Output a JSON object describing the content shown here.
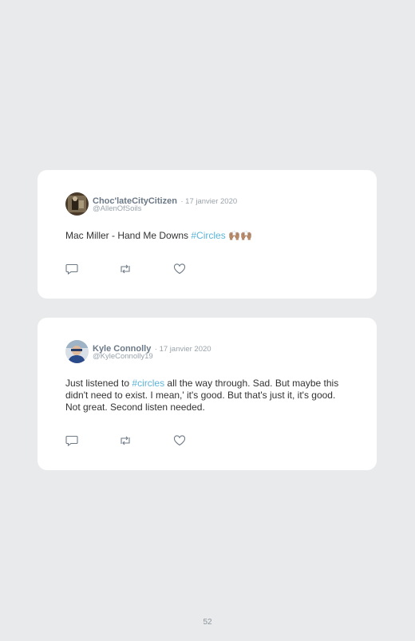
{
  "tweets": [
    {
      "name": "Choc'lateCityCitizen",
      "date": "· 17 janvier 2020",
      "handle": "@AllenOfSoils",
      "text_before": "Mac Miller - Hand Me Downs ",
      "hashtag": "#Circles",
      "text_after": "",
      "emoji": "🙌🏽🙌🏽"
    },
    {
      "name": "Kyle Connolly",
      "date": "· 17 janvier 2020",
      "handle": "@KyleConnolly19",
      "text_before": "Just listened to ",
      "hashtag": "#circles",
      "text_after": " all the way through. Sad. But maybe this didn't need to exist. I mean,' it's good. But that's just it, it's good. Not great. Second listen needed.",
      "emoji": ""
    }
  ],
  "page_number": "52",
  "colors": {
    "background": "#e9eaeb",
    "card": "#ffffff",
    "hashtag": "#5cb4d8",
    "name": "#6b7886",
    "meta": "#9aa3ab"
  },
  "icons": [
    "reply-icon",
    "retweet-icon",
    "like-icon"
  ]
}
